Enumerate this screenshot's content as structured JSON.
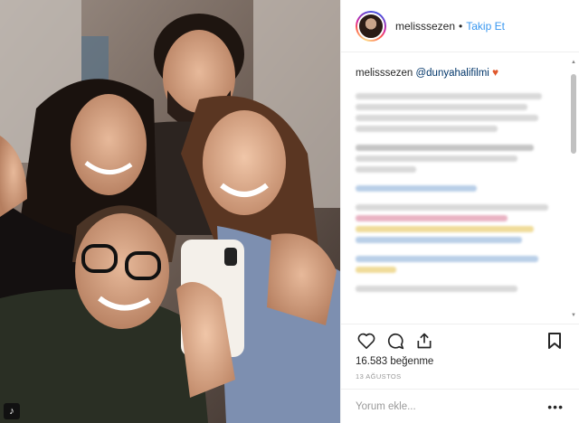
{
  "post": {
    "username": "melisssezen",
    "separator": "•",
    "follow_label": "Takip Et",
    "caption_user": "melisssezen",
    "caption_mention": "@dunyahalifilmi",
    "caption_emoji": "♥",
    "likes_text": "16.583 beğenme",
    "date_text": "13 AĞUSTOS",
    "comment_placeholder": "Yorum ekle...",
    "more_label": "•••"
  },
  "photo": {
    "badge": "♪"
  },
  "colors": {
    "link": "#3897f0",
    "text": "#262626",
    "muted": "#999999",
    "heart_emoji": "#e0582c"
  },
  "icons": [
    "heart-icon",
    "comment-icon",
    "share-icon",
    "bookmark-icon"
  ]
}
